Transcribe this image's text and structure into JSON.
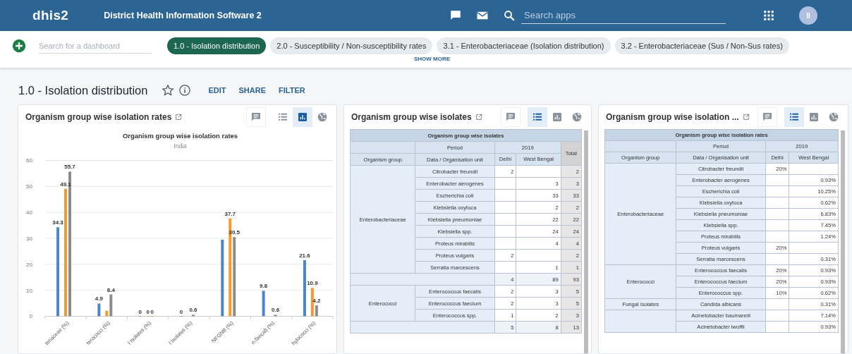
{
  "header": {
    "logo": "dhis2",
    "title": "District Health Information Software 2",
    "search_placeholder": "Search apps",
    "avatar_initials": "II"
  },
  "dashboard_bar": {
    "search_placeholder": "Search for a dashboard",
    "dashboards": [
      {
        "label": "1.0 - Isolation distribution",
        "selected": true
      },
      {
        "label": "2.0 - Susceptibility / Non-susceptibility rates",
        "selected": false
      },
      {
        "label": "3.1 - Enterobacteriaceae (Isolation distribution)",
        "selected": false
      },
      {
        "label": "3.2 - Enterobacteriaceae (Sus / Non-Sus rates)",
        "selected": false
      }
    ],
    "show_more": "SHOW MORE"
  },
  "dashboard": {
    "title": "1.0 - Isolation distribution",
    "starred": false,
    "actions": [
      "EDIT",
      "SHARE",
      "FILTER"
    ]
  },
  "items": [
    {
      "title": "Organism group wise isolation rates",
      "kind": "chart",
      "view_buttons": [
        {
          "kind": "table",
          "selected": false
        },
        {
          "kind": "chart",
          "selected": true
        },
        {
          "kind": "map",
          "selected": false
        }
      ],
      "chart_data": {
        "type": "bar",
        "title": "Organism group wise isolation rates",
        "subtitle": "India",
        "categories": [
          "teriaceae (%)",
          "terococci (%)",
          "l Isolates (%)",
          "l Isolates (%)",
          "NFGNB (%)",
          "n-faecal) (%)",
          "hylococci (%)"
        ],
        "ylim": [
          0,
          60
        ],
        "grid": true,
        "yticks": [
          0,
          10,
          20,
          30,
          40,
          50,
          60
        ],
        "data_labels": true,
        "series": [
          {
            "color": "#4a86c8",
            "values": [
              34.3,
              4.9,
              0,
              0,
              29.5,
              9.8,
              21.6
            ],
            "value_labels": [
              "34.3",
              "4.9",
              "0",
              "0",
              null,
              "9.8",
              "21.6"
            ]
          },
          {
            "color": "#f59a2e",
            "values": [
              49.1,
              2.1,
              0,
              null,
              37.7,
              null,
              10.9
            ],
            "value_labels": [
              "49.1",
              null,
              "0",
              null,
              "37.7",
              null,
              "10.9"
            ]
          },
          {
            "color": "#8c8c8c",
            "values": [
              55.7,
              8.4,
              0,
              0.6,
              30.5,
              0.6,
              4.2
            ],
            "value_labels": [
              "55.7",
              "8.4",
              "0",
              "0.6",
              "30.5",
              "0.6",
              "4.2"
            ]
          }
        ]
      }
    },
    {
      "title": "Organism group wise isolates",
      "kind": "table",
      "view_buttons": [
        {
          "kind": "table",
          "selected": true
        },
        {
          "kind": "chart",
          "selected": false
        },
        {
          "kind": "map",
          "selected": false
        }
      ],
      "table": {
        "title": "Organism group wise isolates",
        "period_label": "Period",
        "period": "2019",
        "group_header": "Organism group",
        "data_header": "Data / Organisation unit",
        "columns": [
          "Delhi",
          "West Bengal"
        ],
        "total_header": "Total",
        "groups": [
          {
            "name": "Enterobacteriaceae",
            "rows": [
              {
                "name": "Citrobacter freundii",
                "column_1": "2",
                "total": "2"
              },
              {
                "name": "Enterobacter aerogenes",
                "column_2": "3",
                "total": "3"
              },
              {
                "name": "Escherichia coli",
                "column_2": "33",
                "total": "33"
              },
              {
                "name": "Klebsiella oxytoca",
                "column_2": "2",
                "total": "2"
              },
              {
                "name": "Klebsiella pneumoniae",
                "column_2": "22",
                "total": "22"
              },
              {
                "name": "Klebsiella spp.",
                "column_2": "24",
                "total": "24"
              },
              {
                "name": "Proteus mirabilis",
                "column_2": "4",
                "total": "4"
              },
              {
                "name": "Proteus vulgaris",
                "column_1": "2",
                "total": "2"
              },
              {
                "name": "Serratia marcescens",
                "column_2": "1",
                "total": "1"
              }
            ],
            "subtotal": {
              "column_1": "4",
              "column_2": "89",
              "total": "93"
            }
          },
          {
            "name": "Enterococci",
            "rows": [
              {
                "name": "Enterococcus faecalis",
                "column_1": "2",
                "column_2": "3",
                "total": "5"
              },
              {
                "name": "Enterococcus faecium",
                "column_1": "2",
                "column_2": "3",
                "total": "5"
              },
              {
                "name": "Enterococcus spp.",
                "column_1": "1",
                "column_2": "2",
                "total": "3"
              }
            ],
            "subtotal": {
              "column_1": "5",
              "column_2": "8",
              "total": "13"
            }
          }
        ]
      }
    },
    {
      "title": "Organism group wise isolation ...",
      "kind": "table",
      "view_buttons": [
        {
          "kind": "table",
          "selected": true
        },
        {
          "kind": "chart",
          "selected": false
        },
        {
          "kind": "map",
          "selected": false
        }
      ],
      "table": {
        "title": "Organism group wise isolation rates",
        "period_label": "Period",
        "period": "2019",
        "group_header": "Organism group",
        "data_header": "Data / Organisation unit",
        "columns": [
          "Delhi",
          "West Bengal"
        ],
        "groups": [
          {
            "name": "Enterobacteriaceae",
            "rows": [
              {
                "name": "Citrobacter freundii",
                "column_1": "20%"
              },
              {
                "name": "Enterobacter aerogenes",
                "column_2": "0.93%"
              },
              {
                "name": "Escherichia coli",
                "column_2": "10.25%"
              },
              {
                "name": "Klebsiella oxytoca",
                "column_2": "0.62%"
              },
              {
                "name": "Klebsiella pneumoniae",
                "column_2": "6.83%"
              },
              {
                "name": "Klebsiella spp.",
                "column_2": "7.45%"
              },
              {
                "name": "Proteus mirabilis",
                "column_2": "1.24%"
              },
              {
                "name": "Proteus vulgaris",
                "column_1": "20%"
              },
              {
                "name": "Serratia marcescens",
                "column_2": "0.31%"
              }
            ]
          },
          {
            "name": "Enterococci",
            "rows": [
              {
                "name": "Enterococcus faecalis",
                "column_1": "20%",
                "column_2": "0.93%"
              },
              {
                "name": "Enterococcus faecium",
                "column_1": "20%",
                "column_2": "0.93%"
              },
              {
                "name": "Enterococcus spp.",
                "column_1": "10%",
                "column_2": "0.62%"
              }
            ]
          },
          {
            "name": "Fungal Isolates",
            "rows": [
              {
                "name": "Candida albicans",
                "column_2": "0.31%"
              }
            ]
          },
          {
            "rows": [
              {
                "name": "Acinetobacter baumannii",
                "column_2": "7.14%"
              },
              {
                "name": "Acinetobacter lwoffii",
                "column_2": "0.93%"
              }
            ]
          }
        ]
      }
    }
  ]
}
